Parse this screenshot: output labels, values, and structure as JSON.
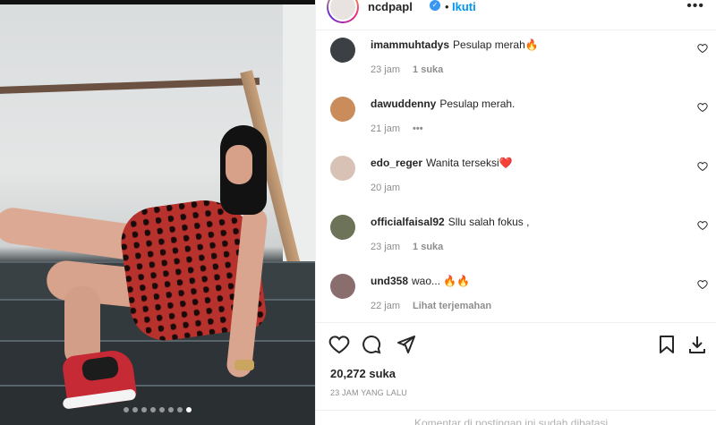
{
  "post": {
    "username": "ncdpapl",
    "separator": "•",
    "follow_label": "Ikuti",
    "more_label": "•••",
    "verified_mark": "✓",
    "image_dots": 8,
    "active_dot": 7
  },
  "comments": [
    {
      "user": "imammuhtadys",
      "text": "Pesulap merah🔥",
      "time": "23 jam",
      "extra": "1 suka",
      "avatar_color": "#3c3f43"
    },
    {
      "user": "dawuddenny",
      "text": "Pesulap merah.",
      "time": "21 jam",
      "extra": "•••",
      "avatar_color": "#c98c5a"
    },
    {
      "user": "edo_reger",
      "text": "Wanita terseksi❤️",
      "time": "20 jam",
      "extra": "",
      "avatar_color": "#d8c2b6"
    },
    {
      "user": "officialfaisal92",
      "text": "Sllu salah fokus ,",
      "time": "23 jam",
      "extra": "1 suka",
      "avatar_color": "#6d7358"
    },
    {
      "user": "und358",
      "text": "wao... 🔥🔥",
      "time": "22 jam",
      "extra": "Lihat terjemahan",
      "avatar_color": "#8a6d6d"
    }
  ],
  "likes_label": "20,272 suka",
  "time_label": "23 JAM YANG LALU",
  "footer_text": "Komentar di postingan ini sudah dibatasi.",
  "colors": {
    "accent": "#0095f6",
    "text": "#262626",
    "muted": "#8e8e8e"
  },
  "icons": [
    "heart-icon",
    "comment-icon",
    "share-icon",
    "bookmark-icon",
    "download-icon"
  ]
}
